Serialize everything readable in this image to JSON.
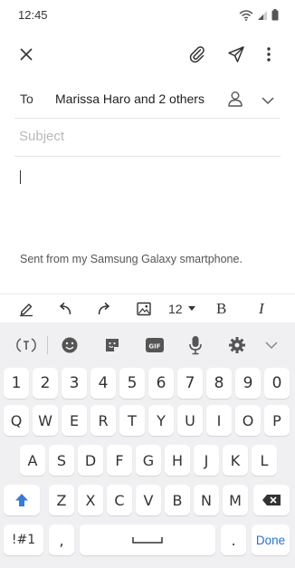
{
  "status_bar": {
    "time": "12:45"
  },
  "toolbar": {
    "close_icon": "close-icon",
    "attach_icon": "paperclip-icon",
    "send_icon": "send-icon",
    "more_icon": "more-vert-icon"
  },
  "compose": {
    "to_label": "To",
    "to_value": "Marissa Haro and 2 others",
    "subject_placeholder": "Subject",
    "signature": "Sent from my Samsung Galaxy smartphone."
  },
  "format_bar": {
    "font_size": "12",
    "bold": "B",
    "italic": "I"
  },
  "keyboard": {
    "row_numbers": [
      "1",
      "2",
      "3",
      "4",
      "5",
      "6",
      "7",
      "8",
      "9",
      "0"
    ],
    "row_1": [
      "Q",
      "W",
      "E",
      "R",
      "T",
      "Y",
      "U",
      "I",
      "O",
      "P"
    ],
    "row_2": [
      "A",
      "S",
      "D",
      "F",
      "G",
      "H",
      "J",
      "K",
      "L"
    ],
    "row_3": [
      "Z",
      "X",
      "C",
      "V",
      "B",
      "N",
      "M"
    ],
    "symbols_key": "!#1",
    "comma_key": ",",
    "period_key": ".",
    "done_key": "Done"
  }
}
